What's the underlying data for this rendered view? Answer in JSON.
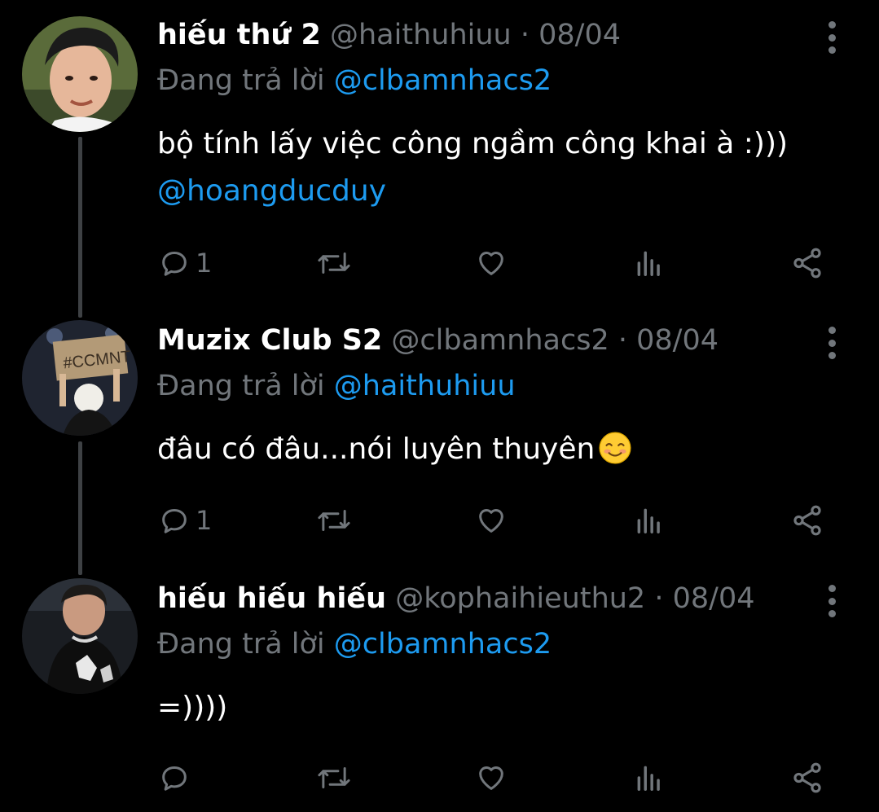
{
  "colors": {
    "background": "#000000",
    "name": "#ffffff",
    "muted": "#71767b",
    "mention": "#1d9bf0",
    "thread_line": "#3e4144"
  },
  "tweets": [
    {
      "name": "hiếu thứ 2",
      "handle": "@haithuhiuu",
      "separator": "·",
      "date": "08/04",
      "reply_prefix": "Đang trả lời",
      "reply_to": "@clbamnhacs2",
      "body_lines": [
        "bộ tính lấy việc công ngầm công khai à :)))"
      ],
      "body_mention": "@hoangducduy",
      "reply_count": "1",
      "icons": [
        "reply-icon",
        "retweet-icon",
        "like-icon",
        "views-icon",
        "share-icon",
        "more-options-icon"
      ]
    },
    {
      "name": "Muzix Club S2",
      "handle": "@clbamnhacs2",
      "separator": "·",
      "date": "08/04",
      "reply_prefix": "Đang trả lời",
      "reply_to": "@haithuhiuu",
      "body_lines": [
        "đâu có đâu...nói luyên thuyên"
      ],
      "emoji": "smiling-face-emoji",
      "reply_count": "1",
      "avatar_sign_text": "#CCMNT",
      "icons": [
        "reply-icon",
        "retweet-icon",
        "like-icon",
        "views-icon",
        "share-icon",
        "more-options-icon"
      ]
    },
    {
      "name": "hiếu hiếu hiếu",
      "handle": "@kophaihieuthu2",
      "separator": "·",
      "date": "08/04",
      "reply_prefix": "Đang trả lời",
      "reply_to": "@clbamnhacs2",
      "body_lines": [
        "=))))"
      ],
      "reply_count": "",
      "icons": [
        "reply-icon",
        "retweet-icon",
        "like-icon",
        "views-icon",
        "share-icon",
        "more-options-icon"
      ]
    }
  ]
}
